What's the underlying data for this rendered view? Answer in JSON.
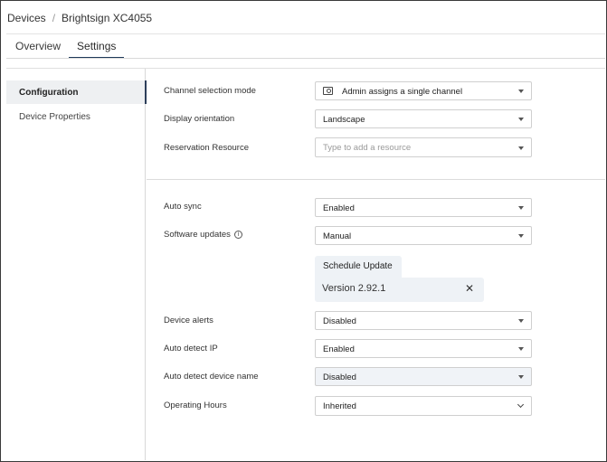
{
  "breadcrumb": {
    "root": "Devices",
    "separator": "/",
    "current": "Brightsign XC4055"
  },
  "tabs": [
    {
      "label": "Overview",
      "active": false
    },
    {
      "label": "Settings",
      "active": true
    }
  ],
  "sidebar": {
    "items": [
      {
        "label": "Configuration",
        "active": true
      },
      {
        "label": "Device Properties",
        "active": false
      }
    ]
  },
  "settings": {
    "channel_selection_mode": {
      "label": "Channel selection mode",
      "value": "Admin assigns a single channel",
      "icon": "channel-icon"
    },
    "display_orientation": {
      "label": "Display orientation",
      "value": "Landscape"
    },
    "reservation_resource": {
      "label": "Reservation Resource",
      "placeholder": "Type to add a resource"
    },
    "auto_sync": {
      "label": "Auto sync",
      "value": "Enabled"
    },
    "software_updates": {
      "label": "Software updates",
      "value": "Manual",
      "icon": "info-icon"
    },
    "schedule_update": {
      "label": "Schedule Update",
      "version": "Version 2.92.1",
      "close_icon": "close-icon"
    },
    "device_alerts": {
      "label": "Device alerts",
      "value": "Disabled"
    },
    "auto_detect_ip": {
      "label": "Auto detect IP",
      "value": "Enabled"
    },
    "auto_detect_device_name": {
      "label": "Auto detect device name",
      "value": "Disabled"
    },
    "operating_hours": {
      "label": "Operating Hours",
      "value": "Inherited"
    }
  },
  "colors": {
    "accent": "#1f3a5a",
    "sidebar_active_bg": "#eef0f2",
    "chip_bg": "#eef2f6",
    "border": "#cfcfcf"
  }
}
